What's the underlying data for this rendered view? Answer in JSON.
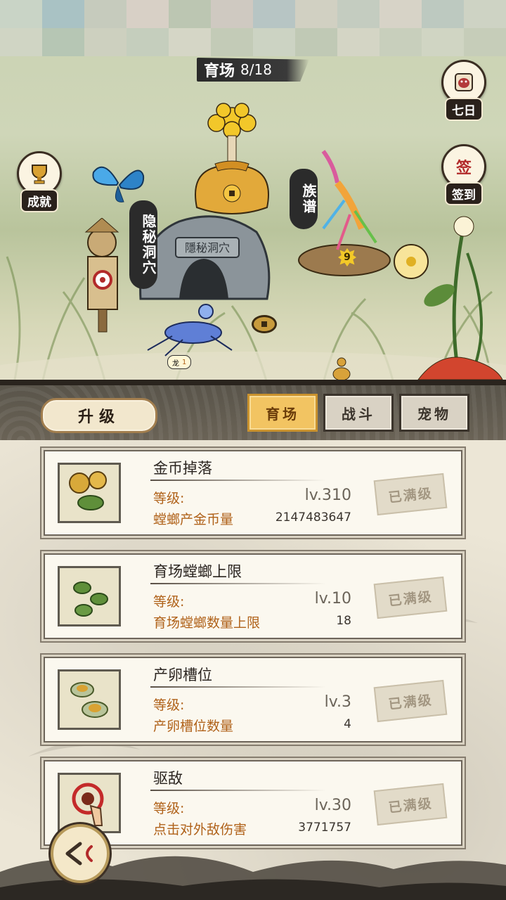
{
  "header": {
    "title": "育场",
    "capacity": "8/18"
  },
  "scene": {
    "achievements_label": "成就",
    "seven_days_label": "七日",
    "sign_in_label": "签到",
    "sign_in_icon_text": "签",
    "hidden_cave_label": "隐秘洞穴",
    "cave_plaque": "隱秘洞穴",
    "clan_tree_label": "族谱",
    "clan_badge_level": "9",
    "mantis_tag_name": "龙",
    "mantis_tag_level": "1"
  },
  "panel": {
    "upgrade_label": "升级",
    "tabs": [
      {
        "label": "育场",
        "active": true
      },
      {
        "label": "战斗",
        "active": false
      },
      {
        "label": "宠物",
        "active": false
      }
    ]
  },
  "upgrades": [
    {
      "name": "金币掉落",
      "level_label": "等级:",
      "level": "lv.310",
      "desc": "螳螂产金币量",
      "value": "2147483647",
      "status": "已满级",
      "icon": "coin-mantis-icon"
    },
    {
      "name": "育场螳螂上限",
      "level_label": "等级:",
      "level": "lv.10",
      "desc": "育场螳螂数量上限",
      "value": "18",
      "status": "已满级",
      "icon": "mantis-group-icon"
    },
    {
      "name": "产卵槽位",
      "level_label": "等级:",
      "level": "lv.3",
      "desc": "产卵槽位数量",
      "value": "4",
      "status": "已满级",
      "icon": "egg-slot-icon"
    },
    {
      "name": "驱敌",
      "level_label": "等级:",
      "level": "lv.30",
      "desc": "点击对外敌伤害",
      "value": "3771757",
      "status": "已满级",
      "icon": "tap-damage-icon"
    }
  ],
  "colors": {
    "active_tab": "#f2c462",
    "orange_text": "#b0621a",
    "dark_frame": "#2a241e"
  }
}
